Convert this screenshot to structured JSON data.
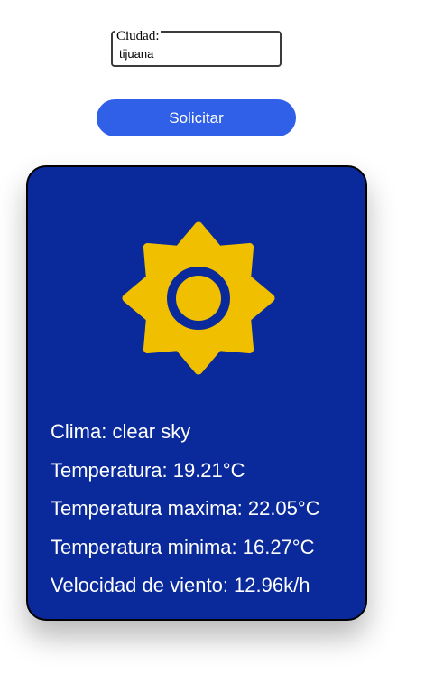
{
  "form": {
    "city_legend": "Ciudad:",
    "city_value": "tijuana",
    "submit_label": "Solicitar"
  },
  "weather": {
    "icon": "sun-icon",
    "icon_color": "#f0c000",
    "card_color": "#0a2a9b",
    "lines": [
      "Clima: clear sky",
      "Temperatura: 19.21°C",
      "Temperatura maxima: 22.05°C",
      "Temperatura minima: 16.27°C",
      "Velocidad de viento: 12.96k/h"
    ]
  }
}
